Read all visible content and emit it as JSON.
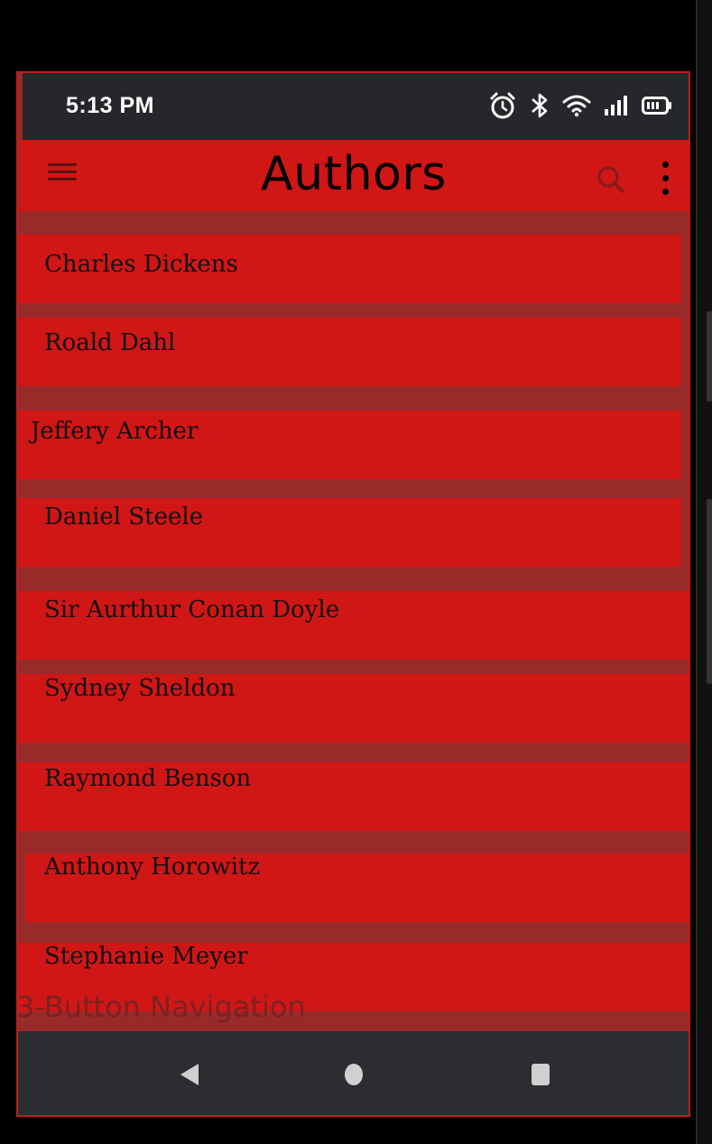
{
  "status_bar": {
    "time": "5:13 PM",
    "icons": [
      "alarm-icon",
      "bluetooth-icon",
      "wifi-icon",
      "signal-icon",
      "battery-icon"
    ]
  },
  "app_bar": {
    "title": "Authors",
    "icons": [
      "menu-icon",
      "search-icon",
      "more-vert-icon"
    ]
  },
  "authors": [
    "Charles Dickens",
    "Roald Dahl",
    "Jeffery Archer",
    "Daniel Steele",
    "Sir Aurthur Conan Doyle",
    "Sydney Sheldon",
    "Raymond Benson",
    "Anthony Horowitz",
    "Stephanie Meyer"
  ],
  "navigation": {
    "label": "3-Button Navigation",
    "buttons": [
      "back-icon",
      "home-icon",
      "recents-icon"
    ]
  },
  "colors": {
    "app_bar": "#d11616",
    "list_item": "#d11616",
    "list_background": "#992a2a",
    "status_bar": "#26272b",
    "nav_bar": "#2c2d31"
  }
}
